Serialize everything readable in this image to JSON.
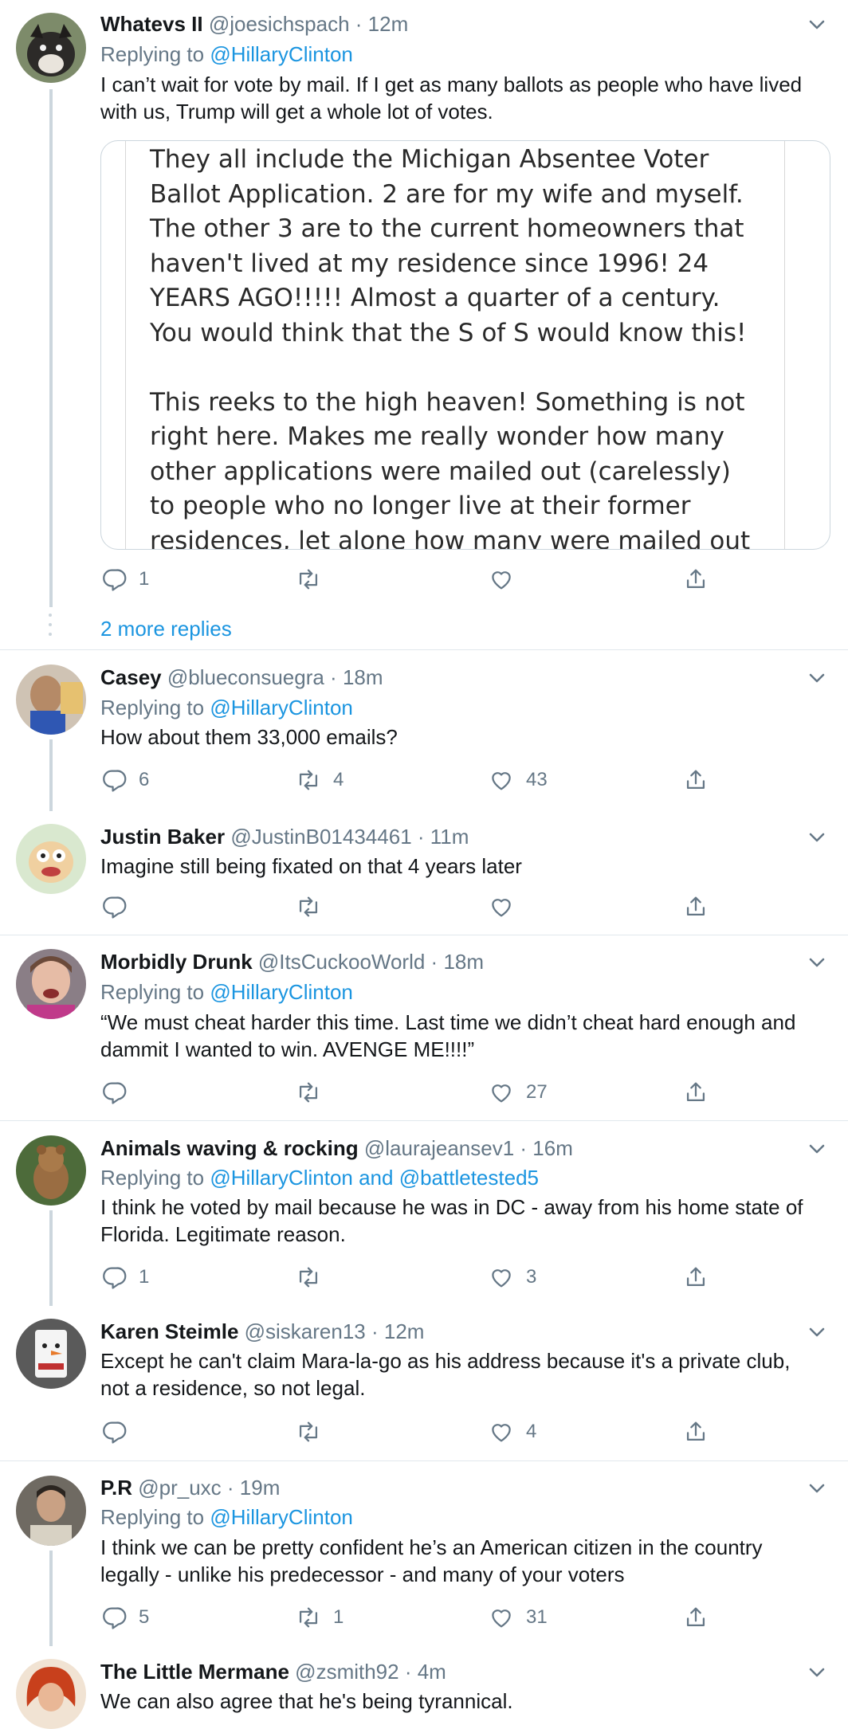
{
  "tweets": [
    {
      "name": "Whatevs II",
      "handle": "@joesichspach",
      "time": "12m",
      "replying_prefix": "Replying to ",
      "replying_to": "@HillaryClinton",
      "text": "I can’t wait for vote by mail. If I get as many ballots as people who have lived with us, Trump will get a whole lot of votes.",
      "quoted_image_text": "They all include the Michigan Absentee Voter Ballot Application. 2 are for my wife and myself. The other 3 are to the current homeowners that haven't lived at my residence since 1996! 24 YEARS AGO!!!!! Almost a quarter of a century. You would think that the S of S would know this!\n\nThis reeks to the high heaven! Something is not right here. Makes me really wonder how many other applications were mailed out (carelessly) to people who no longer live at their former residences, let alone how many were mailed out to",
      "replies": "1",
      "retweets": "",
      "likes": "",
      "more_replies": "2 more replies"
    },
    {
      "name": "Casey",
      "handle": "@blueconsuegra",
      "time": "18m",
      "replying_prefix": "Replying to ",
      "replying_to": "@HillaryClinton",
      "text": "How about them 33,000 emails?",
      "replies": "6",
      "retweets": "4",
      "likes": "43"
    },
    {
      "name": "Justin Baker",
      "handle": "@JustinB01434461",
      "time": "11m",
      "text": "Imagine still being fixated on that 4 years later",
      "replies": "",
      "retweets": "",
      "likes": ""
    },
    {
      "name": "Morbidly Drunk",
      "handle": "@ItsCuckooWorld",
      "time": "18m",
      "replying_prefix": "Replying to ",
      "replying_to": "@HillaryClinton",
      "text": "“We must cheat harder this time.  Last time we didn’t cheat hard enough and dammit I wanted to win. AVENGE ME!!!!”",
      "replies": "",
      "retweets": "",
      "likes": "27"
    },
    {
      "name": "Animals waving & rocking",
      "handle": "@laurajeansev1",
      "time": "16m",
      "replying_prefix": "Replying to ",
      "replying_to": "@HillaryClinton",
      "replying_and": " and ",
      "replying_to_2": "@battletested5",
      "text": "I think he voted by mail because he was in DC - away from his home state of Florida.  Legitimate reason.",
      "replies": "1",
      "retweets": "",
      "likes": "3"
    },
    {
      "name": "Karen Steimle",
      "handle": "@siskaren13",
      "time": "12m",
      "text": "Except he can't claim Mara-la-go as his address because it's a private club, not a residence, so not legal.",
      "replies": "",
      "retweets": "",
      "likes": "4"
    },
    {
      "name": "P.R",
      "handle": "@pr_uxc",
      "time": "19m",
      "replying_prefix": "Replying to ",
      "replying_to": "@HillaryClinton",
      "text": "I think we can be pretty confident he’s an American citizen in the country legally - unlike his predecessor - and many of your voters",
      "replies": "5",
      "retweets": "1",
      "likes": "31"
    },
    {
      "name": "The Little Mermane",
      "handle": "@zsmith92",
      "time": "4m",
      "text": "We can also agree that he's being tyrannical."
    }
  ],
  "separator": " · ",
  "colors": {
    "link": "#1b95e0",
    "secondary": "#657786",
    "thread_line": "#ccd6dd",
    "divider": "#e1e8ed"
  },
  "icons": [
    "reply-icon",
    "retweet-icon",
    "like-icon",
    "share-icon",
    "chevron-down-icon"
  ]
}
